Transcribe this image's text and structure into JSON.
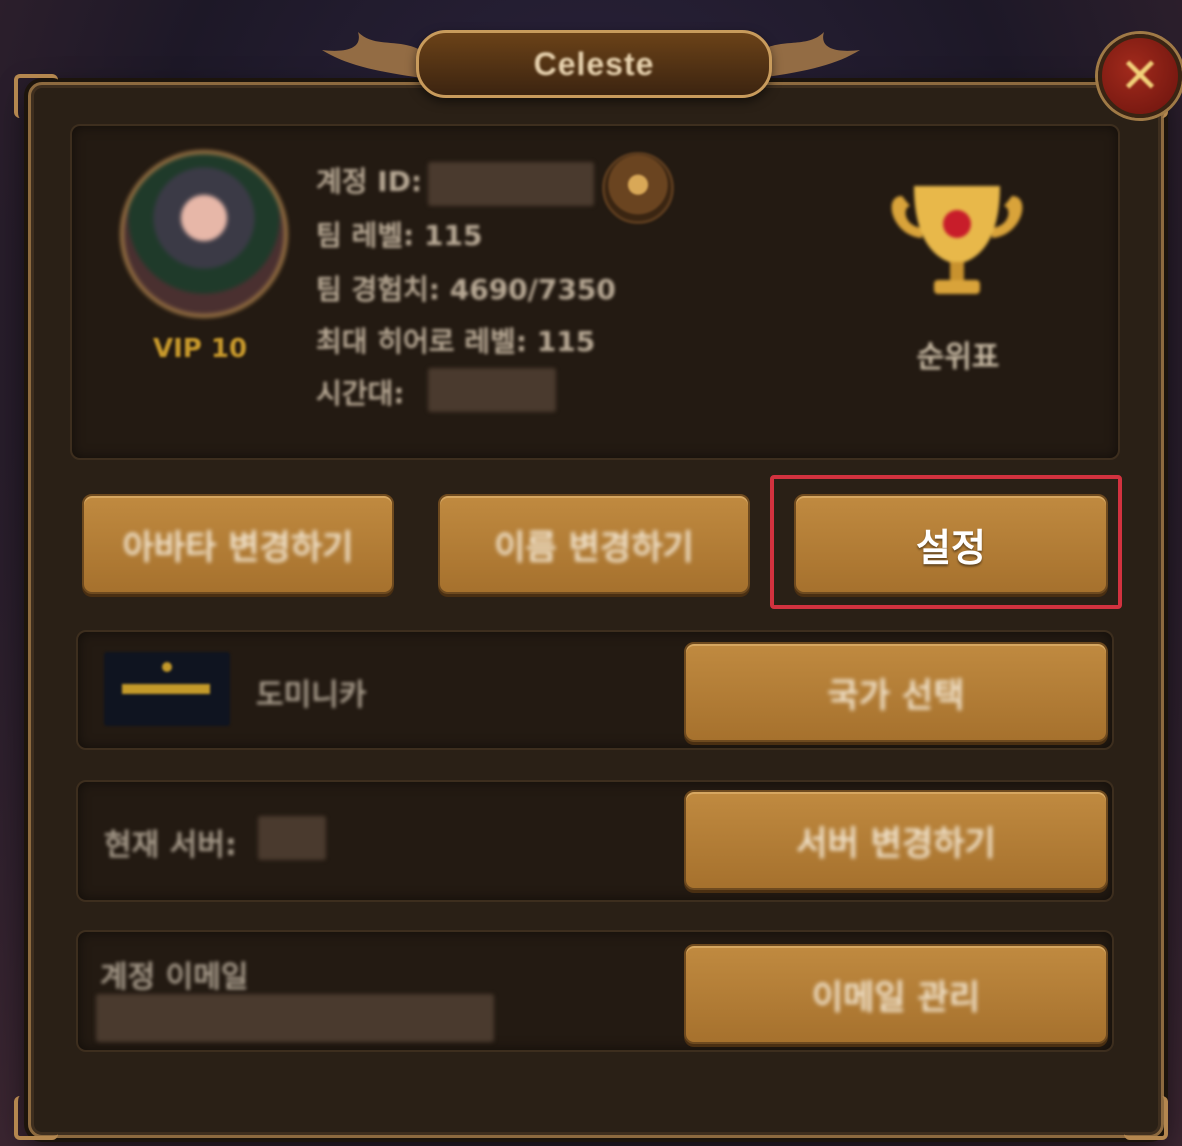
{
  "window": {
    "title": "Celeste"
  },
  "profile": {
    "vip": "VIP 10",
    "account_id_label": "계정 ID:",
    "team_level": "팀 레벨: 115",
    "team_exp": "팀 경험치: 4690/7350",
    "max_hero_level": "최대 히어로 레벨: 115",
    "timezone_label": "시간대:",
    "ranking_label": "순위표"
  },
  "buttons": {
    "change_avatar": "아바타 변경하기",
    "change_name": "이름 변경하기",
    "settings": "설정",
    "select_country": "국가 선택",
    "change_server": "서버 변경하기",
    "manage_email": "이메일 관리"
  },
  "country": {
    "name": "도미니카"
  },
  "server": {
    "label": "현재 서버:"
  },
  "email": {
    "label": "계정 이메일"
  },
  "colors": {
    "accent_gold": "#b27c35",
    "highlight_red": "#d2323f",
    "panel_bg": "#231a12"
  }
}
